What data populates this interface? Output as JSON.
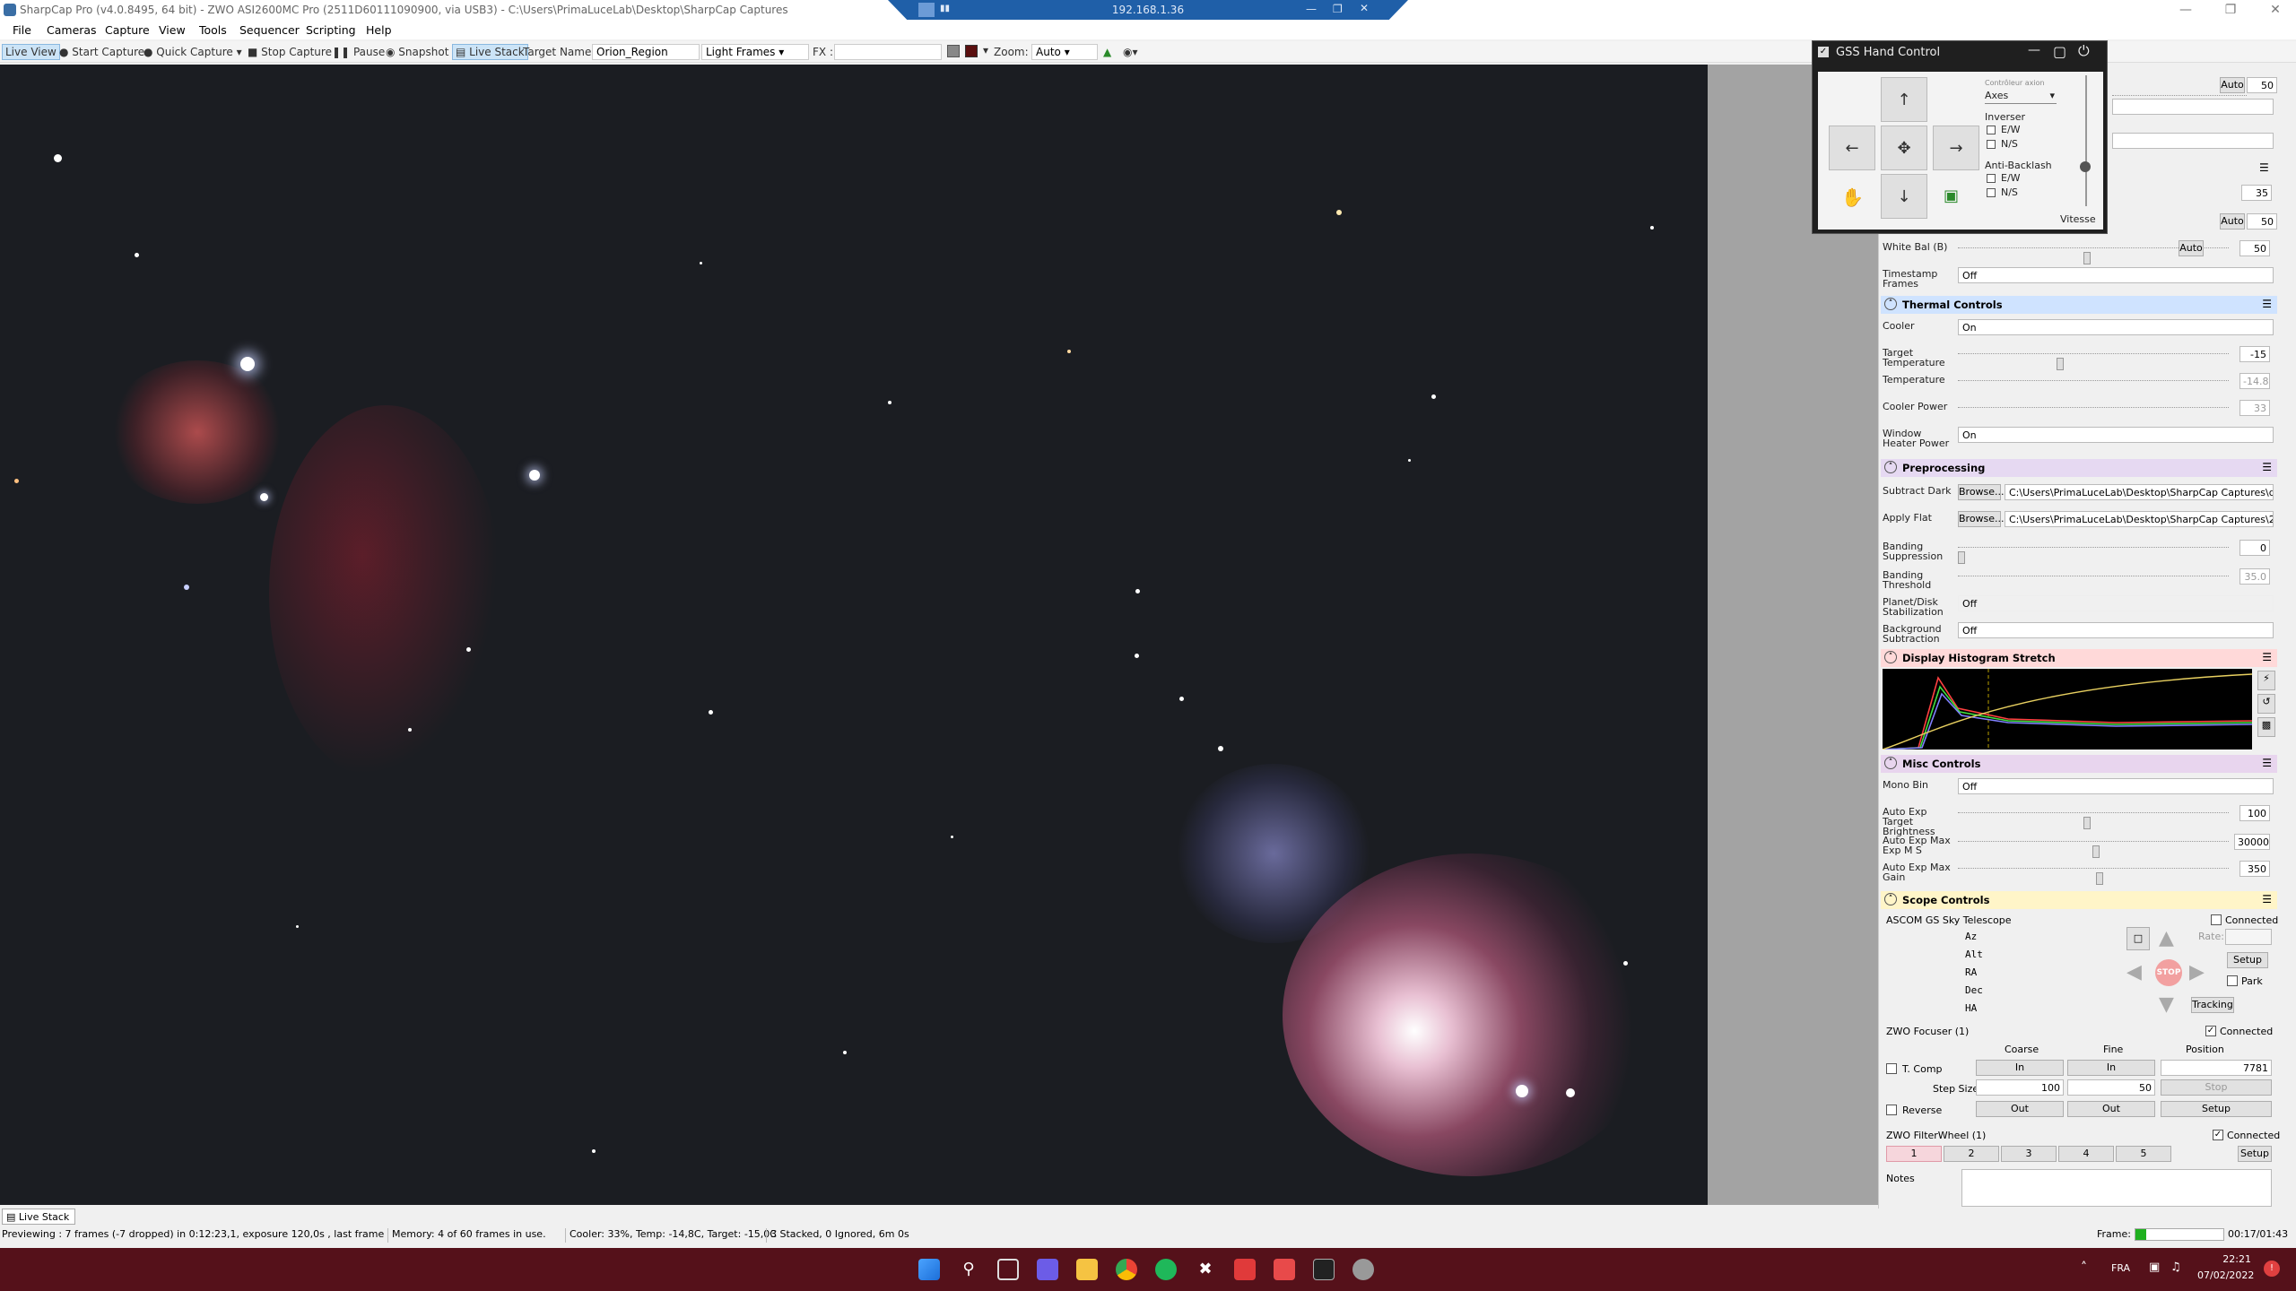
{
  "window": {
    "title": "SharpCap Pro (v4.0.8495, 64 bit) - ZWO ASI2600MC Pro (2511D60111090900, via USB3) - C:\\Users\\PrimaLuceLab\\Desktop\\SharpCap Captures",
    "remote_host": "192.168.1.36"
  },
  "menu": [
    "File",
    "Cameras",
    "Capture",
    "View",
    "Tools",
    "Sequencer",
    "Scripting",
    "Help"
  ],
  "toolbar": {
    "live_view": "Live View",
    "start_capture": "Start Capture",
    "quick_capture": "Quick Capture",
    "stop_capture": "Stop Capture",
    "pause": "Pause",
    "snapshot": "Snapshot",
    "live_stack": "Live Stack",
    "target_label": "Target Name :",
    "target_value": "Orion_Region",
    "frame_type": "Light Frames",
    "fx_label": "FX :",
    "zoom_label": "Zoom:",
    "zoom_value": "Auto"
  },
  "hand_control": {
    "title": "GSS Hand Control",
    "controller_label": "Contrôleur axion",
    "mode": "Axes",
    "inverse_label": "Inverser",
    "ew": "E/W",
    "ns": "N/S",
    "antibacklash_label": "Anti-Backlash",
    "speed_label": "Vitesse"
  },
  "panel": {
    "top_rows": [
      {
        "label": "",
        "value": "50",
        "auto": "Auto"
      },
      {
        "label": "White Bal (B)",
        "value": "50",
        "auto": "Auto"
      }
    ],
    "timestamp_label": "Timestamp Frames",
    "timestamp_value": "Off",
    "thermal": {
      "header": "Thermal Controls",
      "cooler_label": "Cooler",
      "cooler_value": "On",
      "target_label": "Target Temperature",
      "target_value": "-15",
      "temp_label": "Temperature",
      "temp_value": "-14.8",
      "power_label": "Cooler Power",
      "power_value": "33",
      "heater_label": "Window Heater Power",
      "heater_value": "On"
    },
    "preprocessing": {
      "header": "Preprocessing",
      "dark_label": "Subtract Dark",
      "dark_path": "C:\\Users\\PrimaLuceLab\\Desktop\\SharpCap Captures\\d...",
      "flat_label": "Apply Flat",
      "flat_path": "C:\\Users\\PrimaLuceLab\\Desktop\\SharpCap Captures\\2...",
      "browse": "Browse...",
      "banding_label": "Banding Suppression",
      "banding_value": "0",
      "threshold_label": "Banding Threshold",
      "threshold_value": "35.0",
      "stab_label": "Planet/Disk Stabilization",
      "stab_value": "Off",
      "bg_label": "Background Subtraction",
      "bg_value": "Off"
    },
    "histogram": {
      "header": "Display Histogram Stretch"
    },
    "misc": {
      "header": "Misc Controls",
      "monobin_label": "Mono Bin",
      "monobin_value": "Off",
      "target_bright_label": "Auto Exp Target Brightness",
      "target_bright_value": "100",
      "maxexp_label": "Auto Exp Max Exp M S",
      "maxexp_value": "30000",
      "maxgain_label": "Auto Exp Max Gain",
      "maxgain_value": "350"
    },
    "scope": {
      "header": "Scope Controls",
      "mount_name": "ASCOM GS Sky Telescope",
      "connected": "Connected",
      "coords": [
        "Az",
        "Alt",
        "RA",
        "Dec",
        "HA"
      ],
      "rate_label": "Rate:",
      "setup": "Setup",
      "park": "Park",
      "tracking": "Tracking",
      "stop": "STOP"
    },
    "focuser": {
      "name": "ZWO Focuser (1)",
      "connected": "Connected",
      "coarse": "Coarse",
      "fine": "Fine",
      "position": "Position",
      "tcomp": "T. Comp",
      "in": "In",
      "out": "Out",
      "position_value": "7781",
      "stepsize_label": "Step Size",
      "coarse_step": "100",
      "fine_step": "50",
      "stop": "Stop",
      "setup": "Setup",
      "reverse": "Reverse"
    },
    "filterwheel": {
      "name": "ZWO FilterWheel (1)",
      "connected": "Connected",
      "slots": [
        "1",
        "2",
        "3",
        "4",
        "5"
      ],
      "setup": "Setup"
    },
    "notes_label": "Notes"
  },
  "status": {
    "tab": "Live Stack",
    "preview": "Previewing : 7 frames (-7 dropped) in 0:12:23,1, exposure 120,0s , last frame 120,8s",
    "memory": "Memory: 4 of 60 frames in use.",
    "cooler": "Cooler: 33%, Temp: -14,8C, Target: -15,0C",
    "stack": "3 Stacked, 0 Ignored, 6m 0s",
    "frame_label": "Frame:",
    "elapsed": "00:17/01:43"
  },
  "tray": {
    "lang": "FRA",
    "time": "22:21",
    "date": "07/02/2022"
  },
  "colors": {
    "thermal_header": "#cfe3ff",
    "preproc_header": "#e6d9f2",
    "histogram_header": "#ffd9d9",
    "misc_header": "#e8d5ee",
    "scope_header": "#fff5c8",
    "taskbar": "#55111a"
  }
}
